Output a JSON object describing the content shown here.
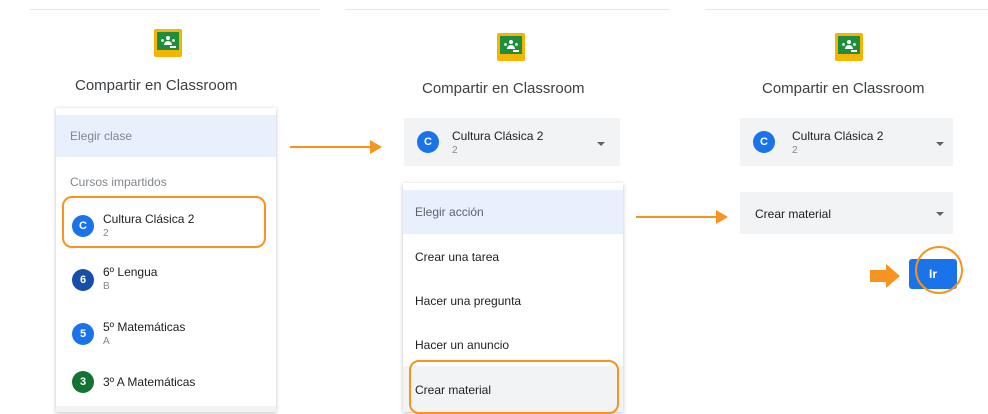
{
  "panels": [
    {
      "title": "Compartir en Classroom",
      "class_placeholder": "Elegir clase",
      "section_label": "Cursos impartidos",
      "courses": [
        {
          "avatar": "C",
          "name": "Cultura Clásica 2",
          "section": "2",
          "color": "#1a73e8"
        },
        {
          "avatar": "6",
          "name": "6º Lengua",
          "section": "B",
          "color": "#174ea6"
        },
        {
          "avatar": "5",
          "name": "5º Matemáticas",
          "section": "A",
          "color": "#1a73e8"
        },
        {
          "avatar": "3",
          "name": "3º A Matemáticas",
          "section": "",
          "color": "#137333"
        }
      ]
    },
    {
      "title": "Compartir en Classroom",
      "selected_class": {
        "avatar": "C",
        "name": "Cultura Clásica 2",
        "section": "2"
      },
      "action_placeholder": "Elegir acción",
      "actions": [
        "Crear una tarea",
        "Hacer una pregunta",
        "Hacer un anuncio",
        "Crear material"
      ]
    },
    {
      "title": "Compartir en Classroom",
      "selected_class": {
        "avatar": "C",
        "name": "Cultura Clásica 2",
        "section": "2"
      },
      "selected_action": "Crear material",
      "go_button": "Ir"
    }
  ],
  "colors": {
    "accent": "#1a73e8",
    "highlight": "#f7931e",
    "selected_bg": "#e8f0fe"
  }
}
